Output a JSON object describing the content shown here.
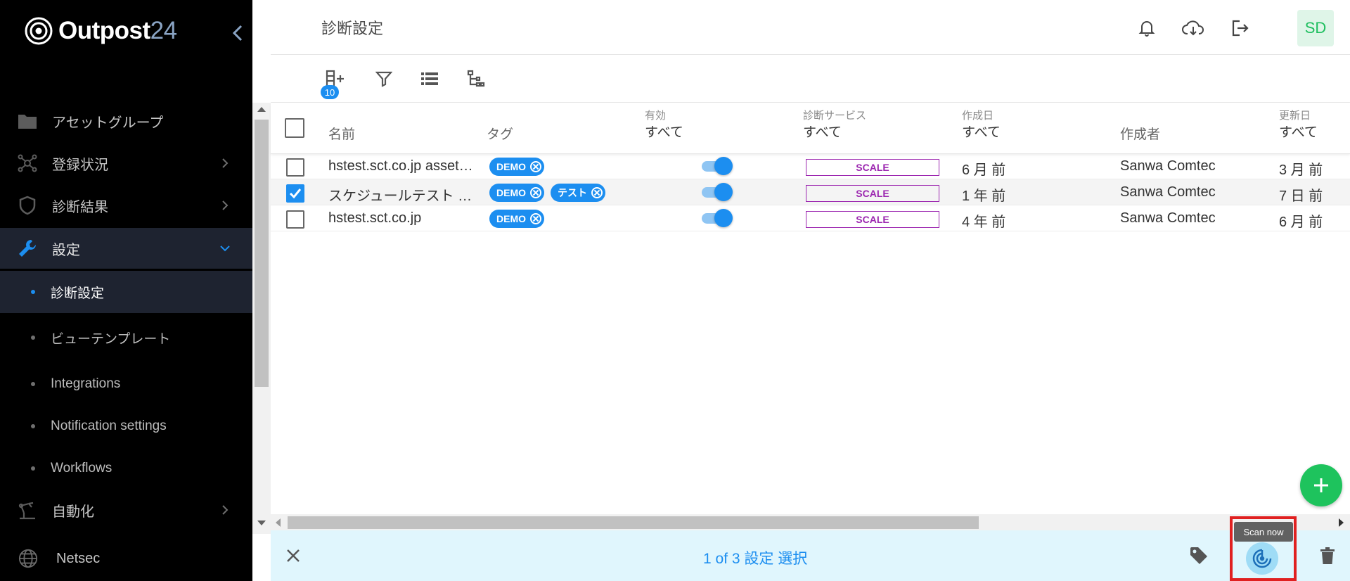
{
  "app": {
    "logo_main": "Outpost",
    "logo_num": "24"
  },
  "sidebar": {
    "items": [
      {
        "label": "アセットグループ",
        "icon": "folder-icon"
      },
      {
        "label": "登録状況",
        "icon": "network-icon"
      },
      {
        "label": "診断結果",
        "icon": "shield-icon"
      },
      {
        "label": "設定",
        "icon": "wrench-icon"
      },
      {
        "label": "自動化",
        "icon": "robot-arm-icon"
      },
      {
        "label": "Netsec",
        "icon": "globe-icon"
      }
    ],
    "sub_items": [
      {
        "label": "診断設定"
      },
      {
        "label": "ビューテンプレート"
      },
      {
        "label": "Integrations"
      },
      {
        "label": "Notification settings"
      },
      {
        "label": "Workflows"
      }
    ]
  },
  "header": {
    "title": "診断設定",
    "avatar": "SD"
  },
  "toolbar": {
    "badge": "10"
  },
  "table": {
    "columns": {
      "name": "名前",
      "tag": "タグ",
      "enabled_label": "有効",
      "enabled_filter": "すべて",
      "service_label": "診断サービス",
      "service_filter": "すべて",
      "created_label": "作成日",
      "created_filter": "すべて",
      "creator": "作成者",
      "updated_label": "更新日",
      "updated_filter": "すべて"
    },
    "rows": [
      {
        "name": "hstest.sct.co.jp asset…",
        "tags": [
          "DEMO"
        ],
        "service": "SCALE",
        "created": "6 月 前",
        "creator": "Sanwa Comtec",
        "updated": "3 月 前",
        "selected": false
      },
      {
        "name": "スケジュールテスト …",
        "tags": [
          "DEMO",
          "テスト"
        ],
        "service": "SCALE",
        "created": "1 年 前",
        "creator": "Sanwa Comtec",
        "updated": "7 日 前",
        "selected": true
      },
      {
        "name": "hstest.sct.co.jp",
        "tags": [
          "DEMO"
        ],
        "service": "SCALE",
        "created": "4 年 前",
        "creator": "Sanwa Comtec",
        "updated": "6 月 前",
        "selected": false
      }
    ]
  },
  "selection": {
    "text": "1 of 3 設定 選択",
    "tooltip": "Scan now"
  },
  "colors": {
    "accent": "#1c8ef0",
    "fab": "#1ec35d",
    "scale_tag": "#9c27b0",
    "highlight": "#e02020"
  }
}
